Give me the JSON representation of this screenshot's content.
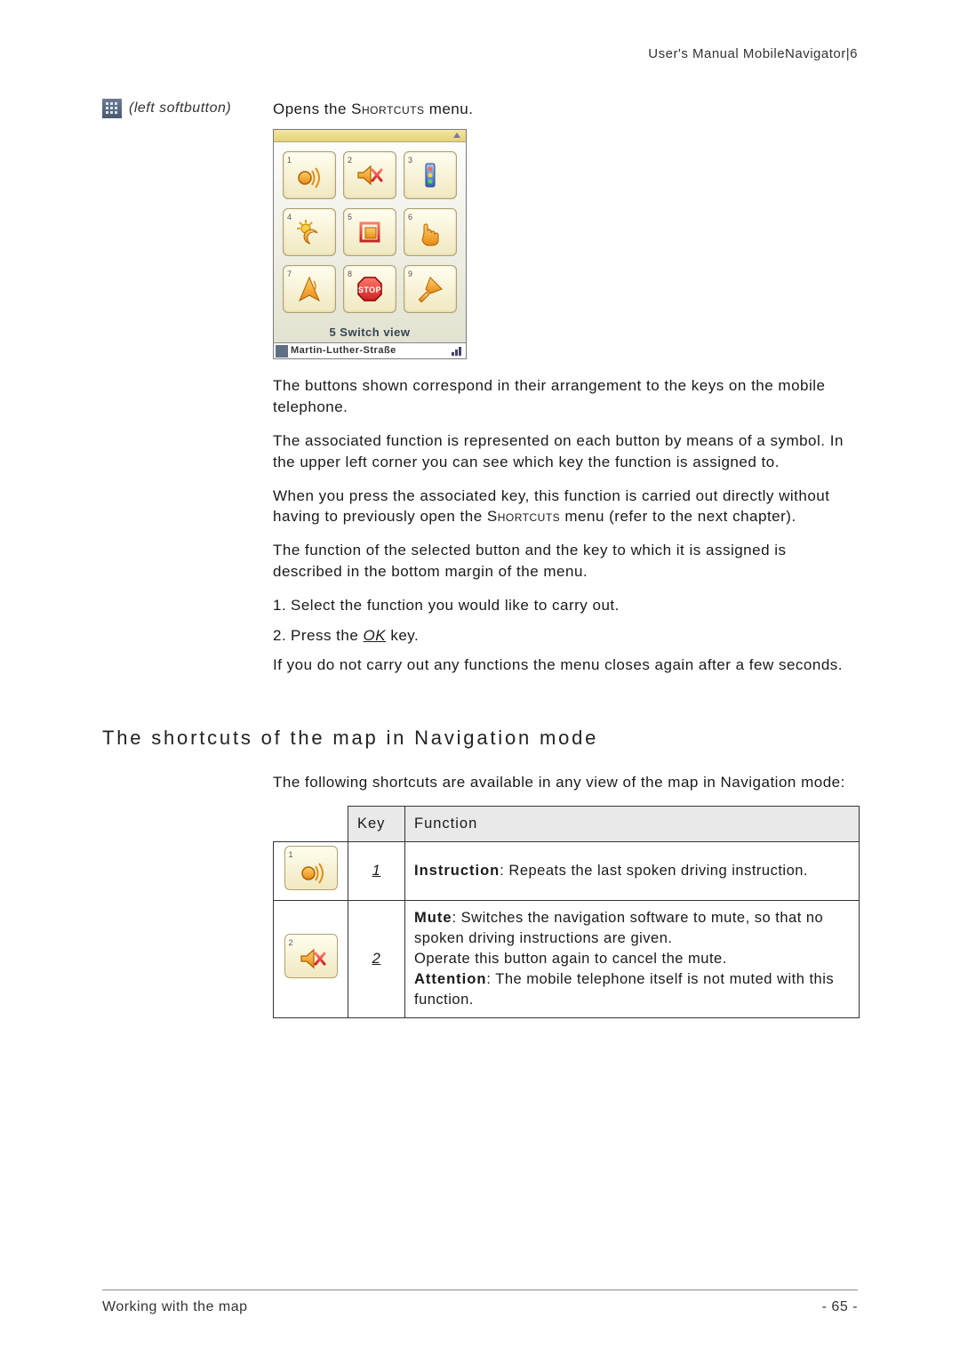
{
  "header": {
    "title": "User's Manual MobileNavigator|6"
  },
  "left": {
    "softbutton_label": "(left softbutton)",
    "icon_name": "grid-icon"
  },
  "intro": {
    "opens_prefix": "Opens the ",
    "shortcuts_caps": "Shortcuts",
    "opens_suffix": " menu."
  },
  "screenshot": {
    "buttons": [
      {
        "n": "1",
        "icon": "speak"
      },
      {
        "n": "2",
        "icon": "mute"
      },
      {
        "n": "3",
        "icon": "route"
      },
      {
        "n": "4",
        "icon": "day-night"
      },
      {
        "n": "5",
        "icon": "view"
      },
      {
        "n": "6",
        "icon": "poi"
      },
      {
        "n": "7",
        "icon": "north"
      },
      {
        "n": "8",
        "icon": "stop"
      },
      {
        "n": "9",
        "icon": "trowel"
      }
    ],
    "selected_label": "5 Switch view",
    "status_text": "Martin-Luther-Straße"
  },
  "paragraphs": {
    "p1": "The buttons shown correspond in their arrangement to the keys on the mobile telephone.",
    "p2": "The associated function is represented on each button by means of a symbol. In the upper left corner you can see which key the function is assigned to.",
    "p3_a": "When you press the associated key, this function is carried out directly without having to previously open the ",
    "p3_caps": "Shortcuts",
    "p3_b": " menu (refer to the next chapter).",
    "p4": "The function of the selected button and the key to which it is assigned is described in the bottom margin of the menu.",
    "step1": "Select the function you would like to carry out.",
    "step2_a": "Press the ",
    "step2_ok": "OK",
    "step2_b": " key.",
    "p5": "If you do not carry out any functions the menu closes again after a few seconds."
  },
  "section2": {
    "heading": "The shortcuts of the map in Navigation mode",
    "intro": "The following shortcuts are available in any view of the map in Navigation mode:"
  },
  "table": {
    "col_key": "Key",
    "col_func": "Function",
    "rows": [
      {
        "num": "1",
        "key": "1",
        "icon": "speak",
        "label": "Instruction",
        "text": ": Repeats the last spoken driving instruction."
      },
      {
        "num": "2",
        "key": "2",
        "icon": "mute",
        "label": "Mute",
        "text": ": Switches the navigation software to mute, so that no spoken driving instructions are given.",
        "extra1": "Operate this button again to cancel the mute.",
        "label2": "Attention",
        "extra2": ": The mobile telephone itself is not muted with this function."
      }
    ]
  },
  "footer": {
    "left": "Working with the map",
    "right": "- 65 -"
  }
}
